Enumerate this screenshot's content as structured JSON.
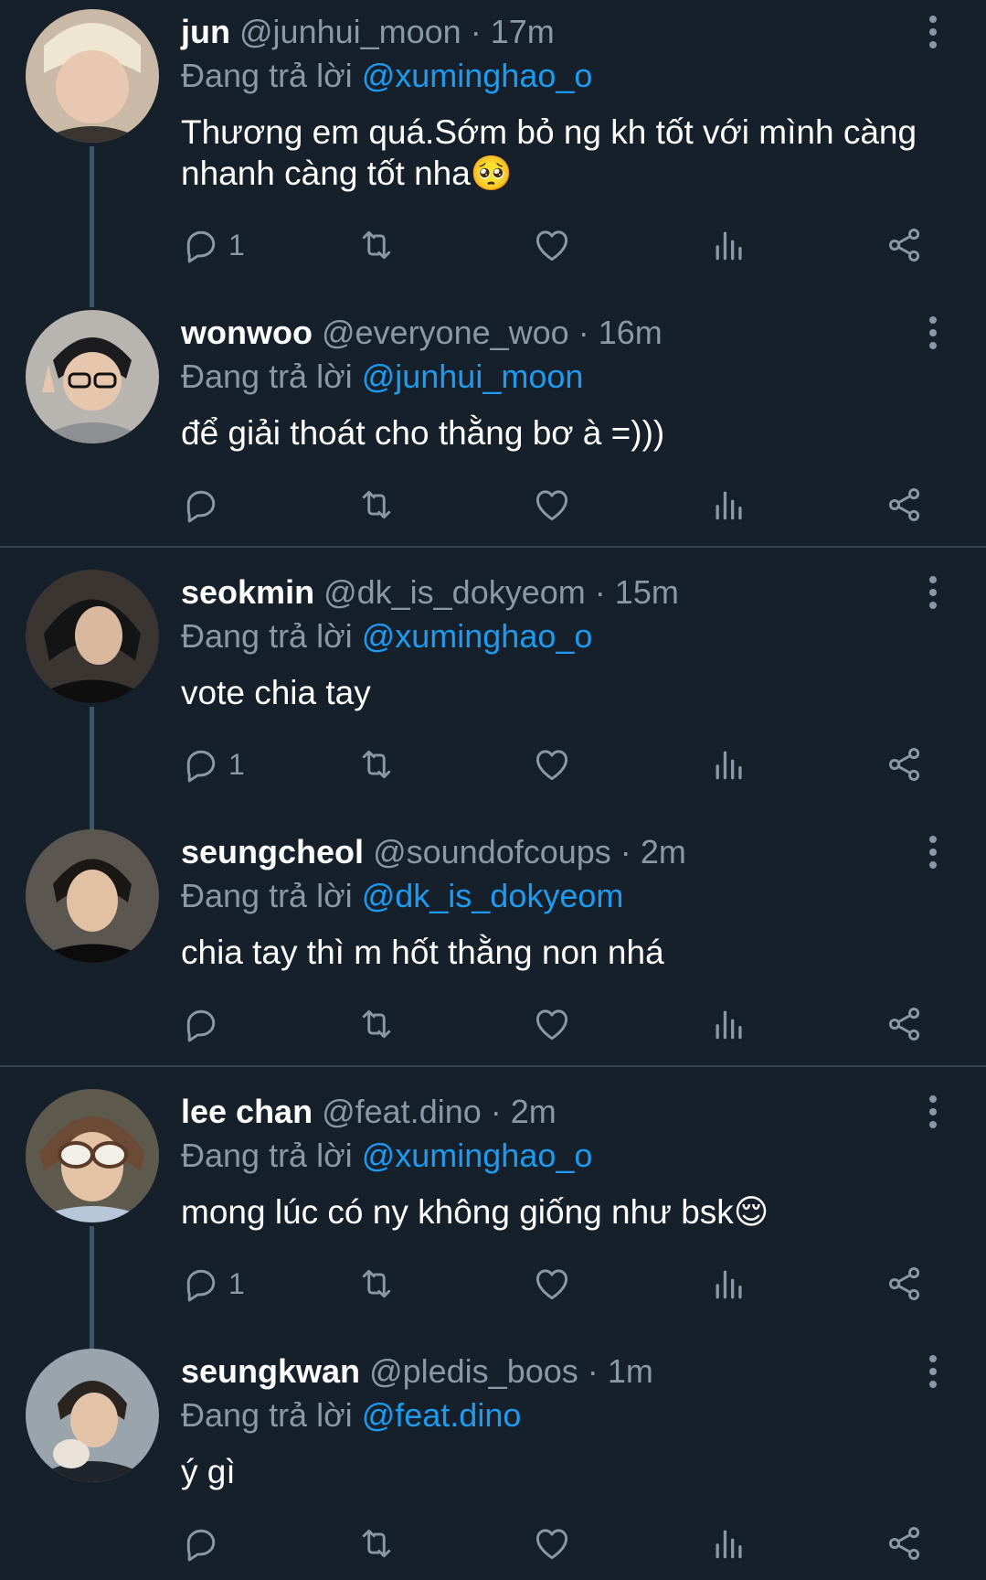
{
  "replying_label": "Đang trả lời",
  "colors": {
    "background": "#15202b",
    "secondary_text": "#8b98a5",
    "mention": "#1d9bf0",
    "divider": "#38444d",
    "thread_line": "#3d5466"
  },
  "tweets": [
    {
      "name": "jun",
      "handle": "@junhui_moon",
      "separator": "·",
      "time": "17m",
      "replying_to": "@xuminghao_o",
      "text": "Thương em quá.Sớm bỏ ng kh tốt với mình càng nhanh càng tốt nha🥺",
      "reply_count": "1",
      "avatar_icon": "avatar-photo"
    },
    {
      "name": "wonwoo",
      "handle": "@everyone_woo",
      "separator": "·",
      "time": "16m",
      "replying_to": "@junhui_moon",
      "text": "để giải thoát cho thằng bơ à =)))",
      "reply_count": "",
      "avatar_icon": "avatar-photo"
    },
    {
      "name": "seokmin",
      "handle": "@dk_is_dokyeom",
      "separator": "·",
      "time": "15m",
      "replying_to": "@xuminghao_o",
      "text": "vote chia tay",
      "reply_count": "1",
      "avatar_icon": "avatar-photo"
    },
    {
      "name": "seungcheol",
      "handle": "@soundofcoups",
      "separator": "·",
      "time": "2m",
      "replying_to": "@dk_is_dokyeom",
      "text": "chia tay thì m hốt thằng non nhá",
      "reply_count": "",
      "avatar_icon": "avatar-photo"
    },
    {
      "name": "lee chan",
      "handle": "@feat.dino",
      "separator": "·",
      "time": "2m",
      "replying_to": "@xuminghao_o",
      "text": "mong lúc có ny không giống như bsk😌",
      "reply_count": "1",
      "avatar_icon": "avatar-photo"
    },
    {
      "name": "seungkwan",
      "handle": "@pledis_boos",
      "separator": "·",
      "time": "1m",
      "replying_to": "@feat.dino",
      "text": "ý gì",
      "reply_count": "",
      "avatar_icon": "avatar-photo"
    }
  ],
  "action_icons": [
    "reply-icon",
    "retweet-icon",
    "like-icon",
    "views-icon",
    "share-icon"
  ]
}
